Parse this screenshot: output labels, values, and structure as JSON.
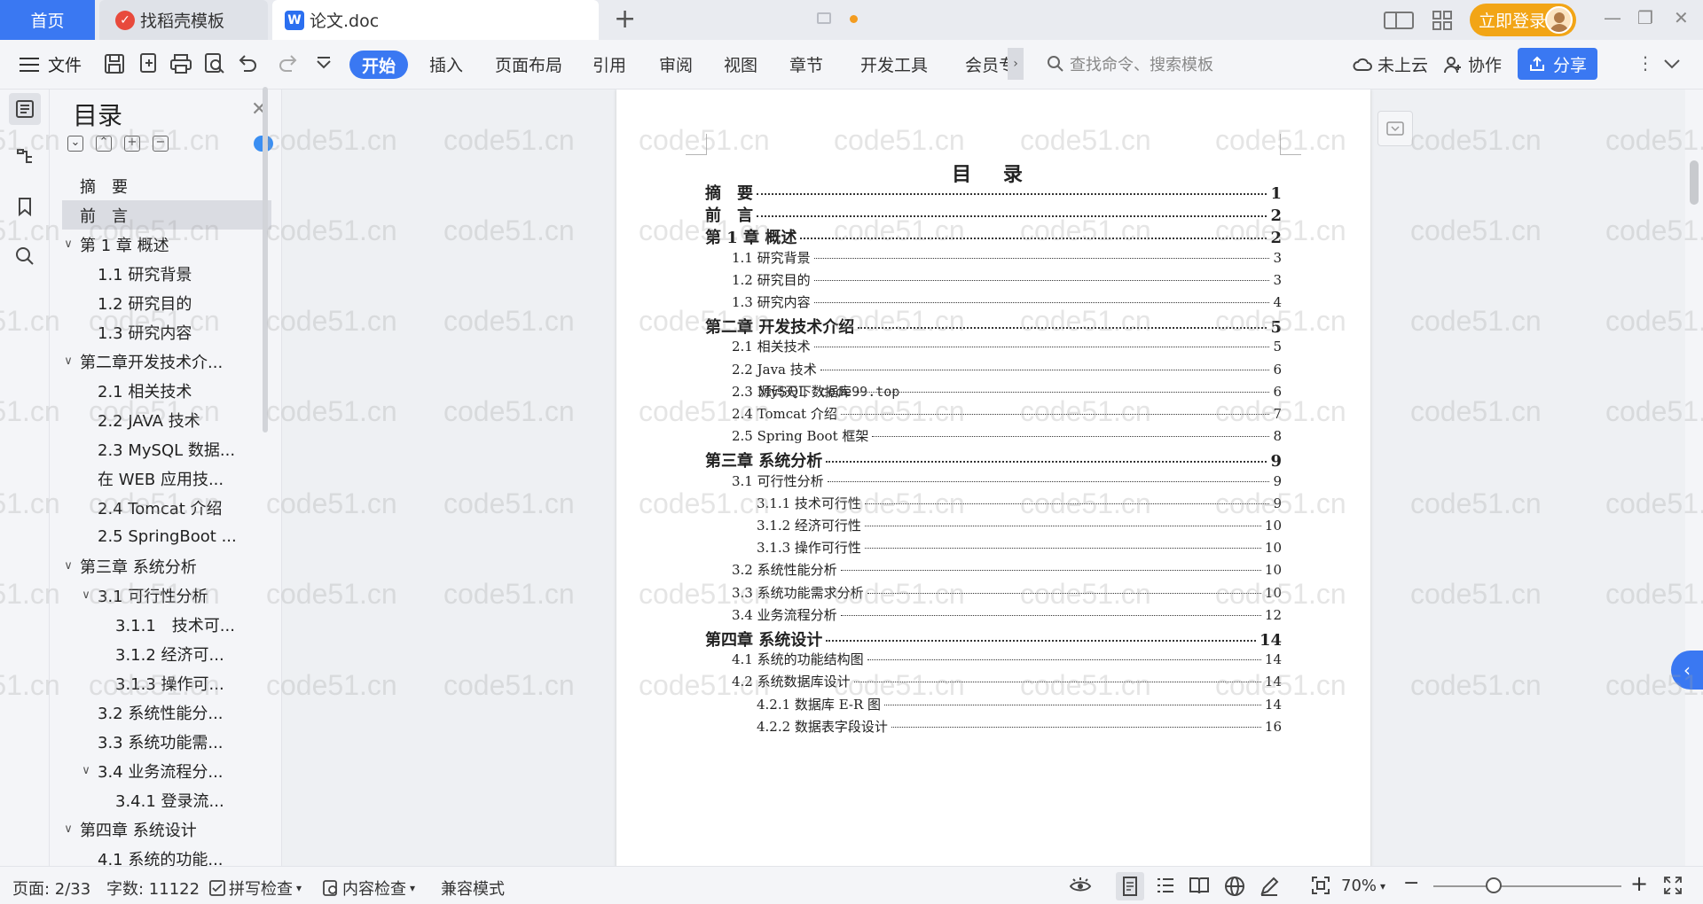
{
  "tabs": {
    "home": "首页",
    "docer": "找稻壳模板",
    "doc": "论文.doc",
    "login": "立即登录"
  },
  "ribbon": {
    "file": "文件",
    "start": "开始",
    "insert": "插入",
    "layout": "页面布局",
    "reference": "引用",
    "review": "审阅",
    "view": "视图",
    "chapter": "章节",
    "devtools": "开发工具",
    "member": "会员专",
    "search_placeholder": "查找命令、搜索模板",
    "cloud": "未上云",
    "collab": "协作",
    "share": "分享"
  },
  "nav": {
    "title": "目录",
    "items": [
      {
        "text": "摘　要",
        "caret": ""
      },
      {
        "text": "前　言",
        "caret": "",
        "selected": true
      },
      {
        "text": "第 1 章  概述",
        "caret": "∨"
      },
      {
        "text": "1.1  研究背景",
        "caret": ""
      },
      {
        "text": "1.2  研究目的",
        "caret": ""
      },
      {
        "text": "1.3  研究内容",
        "caret": ""
      },
      {
        "text": "第二章开发技术介...",
        "caret": "∨"
      },
      {
        "text": "2.1 相关技术",
        "caret": ""
      },
      {
        "text": "2.2 JAVA 技术",
        "caret": ""
      },
      {
        "text": "2.3 MySQL 数据...",
        "caret": ""
      },
      {
        "text": "在 WEB 应用技...",
        "caret": ""
      },
      {
        "text": "2.4 Tomcat 介绍",
        "caret": ""
      },
      {
        "text": "2.5 SpringBoot ...",
        "caret": ""
      },
      {
        "text": "第三章  系统分析",
        "caret": "∨"
      },
      {
        "text": "3.1  可行性分析",
        "caret": "∨"
      },
      {
        "text": "3.1.1　技术可...",
        "caret": ""
      },
      {
        "text": "3.1.2  经济可...",
        "caret": ""
      },
      {
        "text": "3.1.3  操作可...",
        "caret": ""
      },
      {
        "text": "3.2  系统性能分...",
        "caret": ""
      },
      {
        "text": "3.3  系统功能需...",
        "caret": ""
      },
      {
        "text": "3.4  业务流程分...",
        "caret": "∨"
      },
      {
        "text": "3.4.1 登录流...",
        "caret": ""
      },
      {
        "text": " 第四章  系统设计",
        "caret": "∨"
      },
      {
        "text": "4.1  系统的功能...",
        "caret": ""
      }
    ]
  },
  "page": {
    "title": "目 录",
    "toc": [
      {
        "level": 1,
        "text": "摘　要",
        "page": "1"
      },
      {
        "level": 1,
        "text": "前　言",
        "page": "2"
      },
      {
        "level": 1,
        "text": "第 1 章  概述",
        "page": "2"
      },
      {
        "level": 2,
        "text": "1.1 研究背景",
        "page": "3"
      },
      {
        "level": 2,
        "text": "1.2 研究目的",
        "page": "3"
      },
      {
        "level": 2,
        "text": "1.3 研究内容",
        "page": "4"
      },
      {
        "level": 1,
        "text": "第二章  开发技术介绍",
        "page": "5"
      },
      {
        "level": 2,
        "text": "2.1 相关技术",
        "page": "5"
      },
      {
        "level": 2,
        "text": "2.2 Java 技术",
        "page": "6"
      },
      {
        "level": 2,
        "text": "2.3 MySQL 数据库",
        "page": "6"
      },
      {
        "level": 2,
        "text": "2.4 Tomcat 介绍",
        "page": "7"
      },
      {
        "level": 2,
        "text": "2.5 Spring  Boot 框架",
        "page": "8"
      },
      {
        "level": 1,
        "text": "第三章  系统分析",
        "page": "9"
      },
      {
        "level": 2,
        "text": "3.1 可行性分析",
        "page": "9"
      },
      {
        "level": 3,
        "text": "3.1.1  技术可行性",
        "page": "9"
      },
      {
        "level": 3,
        "text": "3.1.2 经济可行性",
        "page": "10"
      },
      {
        "level": 3,
        "text": "3.1.3 操作可行性",
        "page": "10"
      },
      {
        "level": 2,
        "text": "3.2 系统性能分析",
        "page": "10"
      },
      {
        "level": 2,
        "text": "3.3 系统功能需求分析",
        "page": "10"
      },
      {
        "level": 2,
        "text": "3.4 业务流程分析",
        "page": "12"
      },
      {
        "level": 1,
        "text": "第四章  系统设计",
        "page": "14"
      },
      {
        "level": 2,
        "text": "4.1 系统的功能结构图",
        "page": "14"
      },
      {
        "level": 2,
        "text": "4.2 系统数据库设计",
        "page": "14"
      },
      {
        "level": 3,
        "text": "4.2.1  数据库 E-R 图",
        "page": "14"
      },
      {
        "level": 3,
        "text": "4.2.2  数据表字段设计",
        "page": "16"
      }
    ],
    "overlay": "源码天下 code99.top"
  },
  "watermark": "code51.cn",
  "status": {
    "page": "页面: 2/33",
    "words": "字数: 11122",
    "spell": "拼写检查",
    "content": "内容检查",
    "compat": "兼容模式",
    "zoom": "70%"
  },
  "colors": {
    "accent": "#3a78f2",
    "login": "#f2a516"
  }
}
